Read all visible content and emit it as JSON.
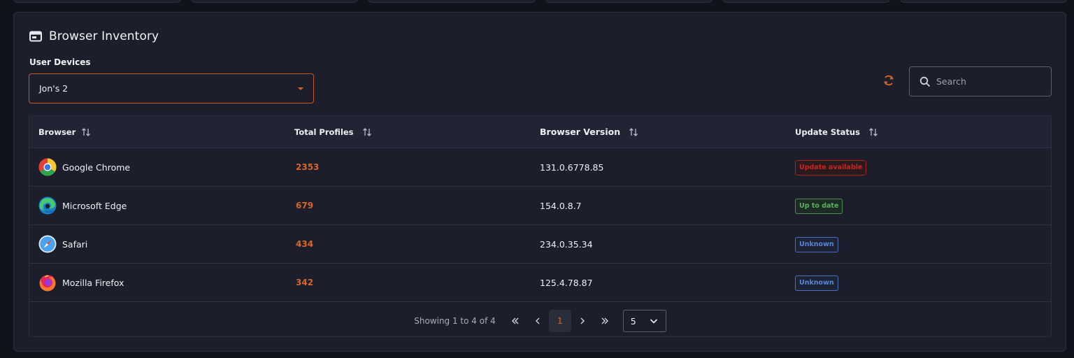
{
  "panel": {
    "title": "Browser Inventory",
    "device_label": "User Devices",
    "device_selected": "Jon's 2"
  },
  "search": {
    "placeholder": "Search"
  },
  "table": {
    "headers": [
      "Browser",
      "Total Profiles",
      "Browser Version",
      "Update Status"
    ],
    "rows": [
      {
        "icon": "chrome-icon",
        "browser": "Google Chrome",
        "profiles": "2353",
        "version": "131.0.6778.85",
        "status": "Update available",
        "status_type": "red"
      },
      {
        "icon": "edge-icon",
        "browser": "Microsoft Edge",
        "profiles": "679",
        "version": "154.0.8.7",
        "status": "Up to date",
        "status_type": "green"
      },
      {
        "icon": "safari-icon",
        "browser": "Safari",
        "profiles": "434",
        "version": "234.0.35.34",
        "status": "Unknown",
        "status_type": "blue"
      },
      {
        "icon": "firefox-icon",
        "browser": "Mozilla Firefox",
        "profiles": "342",
        "version": "125.4.78.87",
        "status": "Unknown",
        "status_type": "blue"
      }
    ]
  },
  "pagination": {
    "info": "Showing 1 to 4 of 4",
    "current_page": "1",
    "page_size": "5"
  },
  "colors": {
    "accent": "#d8662a",
    "danger": "#c8261e",
    "success": "#5bb05e",
    "info": "#5b84d6",
    "panel": "#1c1f2b",
    "background": "#10131c"
  }
}
